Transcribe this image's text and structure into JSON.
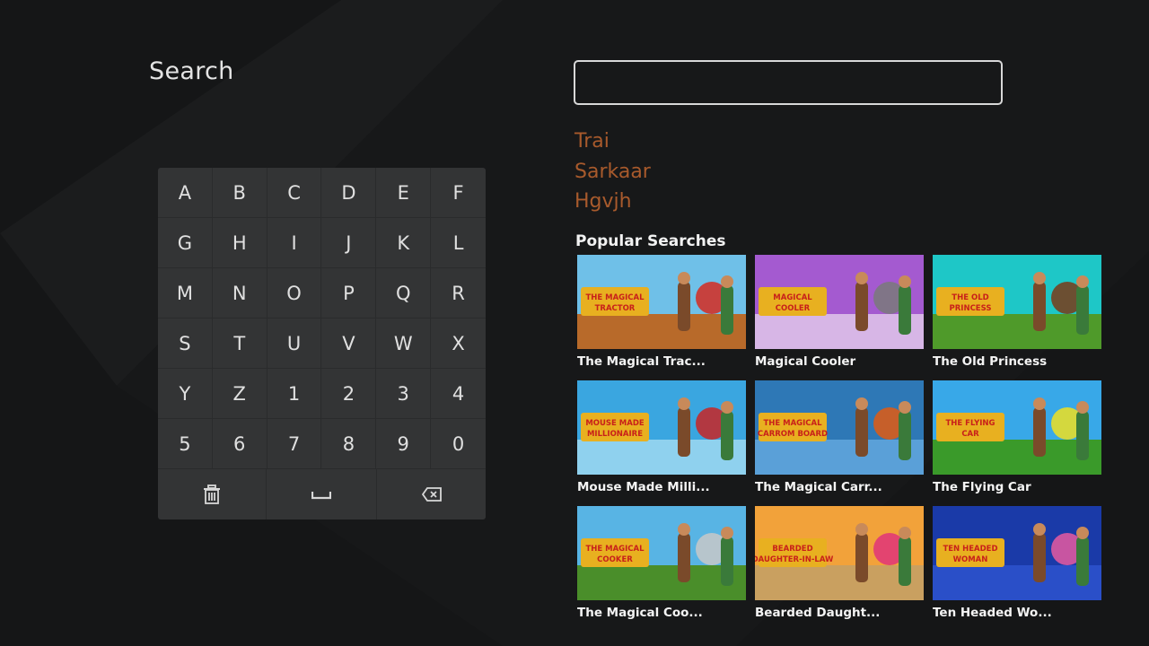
{
  "page": {
    "title": "Search"
  },
  "search": {
    "value": "",
    "placeholder": ""
  },
  "recent_searches": [
    "Trai",
    "Sarkaar",
    "Hgvjh"
  ],
  "keyboard": {
    "keys": [
      "A",
      "B",
      "C",
      "D",
      "E",
      "F",
      "G",
      "H",
      "I",
      "J",
      "K",
      "L",
      "M",
      "N",
      "O",
      "P",
      "Q",
      "R",
      "S",
      "T",
      "U",
      "V",
      "W",
      "X",
      "Y",
      "Z",
      "1",
      "2",
      "3",
      "4",
      "5",
      "6",
      "7",
      "8",
      "9",
      "0"
    ],
    "actions": [
      {
        "name": "clear-all",
        "icon": "trash-icon"
      },
      {
        "name": "space",
        "icon": "space-icon"
      },
      {
        "name": "backspace",
        "icon": "backspace-icon"
      }
    ]
  },
  "popular": {
    "title": "Popular Searches",
    "items": [
      {
        "title": "The Magical Trac...",
        "thumb_text": "THE MAGICAL TRACTOR",
        "sky": "#6fc0e8",
        "ground": "#b86a2a",
        "accent": "#d62a20"
      },
      {
        "title": "Magical Cooler",
        "thumb_text": "MAGICAL COOLER",
        "sky": "#a45ad0",
        "ground": "#d7b6e6",
        "accent": "#7a7a7a"
      },
      {
        "title": "The Old Princess",
        "thumb_text": "THE OLD PRINCESS",
        "sky": "#1ec7c7",
        "ground": "#4f9a2a",
        "accent": "#7a3a18"
      },
      {
        "title": "Mouse Made Milli...",
        "thumb_text": "MOUSE MADE MILLIONAIRE",
        "sky": "#3aa6e0",
        "ground": "#8fd1ee",
        "accent": "#c82424"
      },
      {
        "title": "The Magical Carr...",
        "thumb_text": "THE MAGICAL CARROM BOARD",
        "sky": "#2e78b6",
        "ground": "#5aa0d8",
        "accent": "#e05a12"
      },
      {
        "title": "The Flying Car",
        "thumb_text": "THE FLYING CAR",
        "sky": "#38a8e8",
        "ground": "#3a9a2a",
        "accent": "#f0e020"
      },
      {
        "title": "The Magical Coo...",
        "thumb_text": "THE MAGICAL COOKER",
        "sky": "#58b4e4",
        "ground": "#4a8e2a",
        "accent": "#c8c8c8"
      },
      {
        "title": "Bearded Daught...",
        "thumb_text": "BEARDED DAUGHTER-IN-LAW",
        "sky": "#f2a23a",
        "ground": "#c9a060",
        "accent": "#e0347a"
      },
      {
        "title": "Ten Headed Wo...",
        "thumb_text": "TEN HEADED WOMAN",
        "sky": "#1a3aa8",
        "ground": "#2a4fc8",
        "accent": "#e85aa0"
      }
    ]
  },
  "colors": {
    "background": "#151617",
    "keyboard": "#333435",
    "recent_text": "#a85a2c",
    "title_banner": "#e8b020",
    "title_banner_text": "#c8201a"
  }
}
